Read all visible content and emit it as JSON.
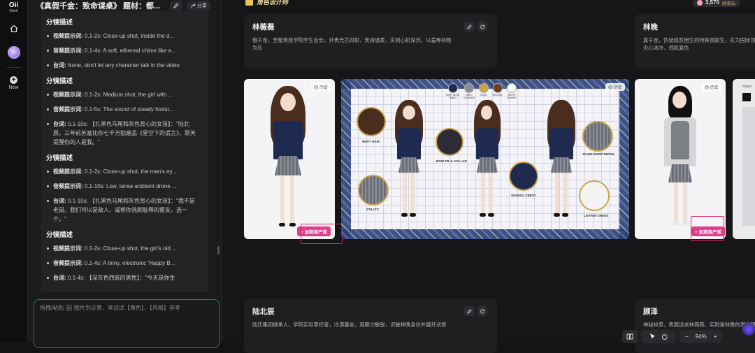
{
  "app": {
    "logo": "Oii",
    "logo_sub": "Oiioii"
  },
  "rail": {
    "new_label": "New"
  },
  "chat": {
    "title": "《真假千金：致命谍桌》 题材：都...",
    "share_label": "分享",
    "sections": [
      {
        "title": "分镜描述",
        "items": [
          {
            "key": "视频提示词:",
            "text": "0.1-2s: Close-up shot, inside the d...",
            "one": true
          },
          {
            "key": "音频提示词:",
            "text": "0.1-4s: A soft, ethereal chime like a...",
            "one": true
          },
          {
            "key": "台词:",
            "text": "None, don't let any character talk in the video",
            "one": false
          }
        ]
      },
      {
        "title": "分镜描述",
        "items": [
          {
            "key": "视频提示词:",
            "text": "0.1-2s: Medium shot, the girl with ...",
            "one": true
          },
          {
            "key": "音频提示词:",
            "text": "0.1-5s: The sound of steady footst...",
            "one": true
          },
          {
            "key": "台词:",
            "text": "0.1-10s: 【扎黑色马尾和灰色背心的女孩】：\"陆北辰，三年前苏富比你七千万拍废品《星空下的谎言》，那天提醒你的人是我。\"",
            "one": false
          }
        ]
      },
      {
        "title": "分镜描述",
        "items": [
          {
            "key": "视频提示词:",
            "text": "0.1-2s: Close-up shot, the man's ey...",
            "one": true
          },
          {
            "key": "音频提示词:",
            "text": "0.1-10s: Low, tense ambient drone ...",
            "one": true
          },
          {
            "key": "台词:",
            "text": "0.1-10s: 【扎黑色马尾和灰色背心的女孩】：\"我不是老鼠。我们可以是敌人，或帮你洗刷耻辱的盟友。选一个。\"",
            "one": false
          }
        ]
      },
      {
        "title": "分镜描述",
        "items": [
          {
            "key": "视频提示词:",
            "text": "0.1-2s: Close-up shot, the girl's old ...",
            "one": true
          },
          {
            "key": "音频提示词:",
            "text": "0.1-4s: A tinny, electronic 'Happy B...",
            "one": true
          },
          {
            "key": "台词:",
            "text": "0.1-4s: 【深灰色西装的男性】：\"今天是你生",
            "one": true
          }
        ]
      }
    ],
    "input_placeholder": "拖拽/粘贴 🖼 图片到这里，来试试【角色】、【风格】参考"
  },
  "canvas": {
    "section_label": "角色设计师",
    "credits": "3,570",
    "plan": "随意玩",
    "characters": [
      {
        "name": "林薇薇",
        "desc": "假千金，圣樱贵族学院学生会长，外表光芒四射、笑容温柔，实则心机深沉，以羞辱林晚为乐"
      },
      {
        "name": "林晚",
        "desc": "真千金，伪装成贫困生的特殊资助生，实为国际顶尖心冰冷，伺机复仇"
      },
      {
        "name": "陆北辰",
        "desc": "陆氏集团继承人，学院实际掌控者，冷漠寡言，观察力敏锐，识破林晚身份并展开试探"
      },
      {
        "name": "顾泽",
        "desc": "神秘校草，表面追求林薇薇，实则是林晚的潜伏盟"
      }
    ],
    "history_label": "历史",
    "add_asset_label": "+ 加到资产库",
    "sheet": {
      "swatches": [
        {
          "name": "NAVY BLUE",
          "sub": "(Main)",
          "color": "#1f2b55"
        },
        {
          "name": "GREY",
          "sub": "(Auxiliary)",
          "color": "#8b8d96"
        },
        {
          "name": "GOLD",
          "sub": "",
          "color": "#c9a44a"
        },
        {
          "name": "BROWN",
          "sub": "",
          "color": "#6b3f25"
        },
        {
          "name": "WHITE",
          "sub": "(Accent)",
          "color": "#ffffff"
        }
      ],
      "labels": {
        "wavy": "WAVY HAIR",
        "bow": "BOW TIE & COLLAR",
        "plaid": "PLAID SKIRT DETAIL",
        "crest": "SCHOOL CREST",
        "loafer": "LOAFER SHOES",
        "socks": "STILLTS"
      }
    },
    "zoom": "94%",
    "colors_label": "COLO"
  }
}
